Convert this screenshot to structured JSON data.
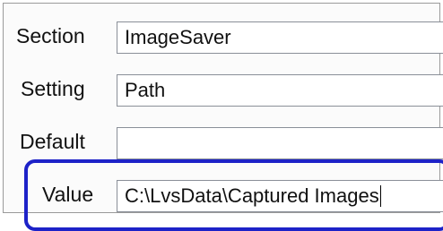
{
  "form": {
    "section": {
      "label": "Section",
      "value": "ImageSaver"
    },
    "setting": {
      "label": "Setting",
      "value": "Path"
    },
    "default": {
      "label": "Default",
      "value": ""
    },
    "value": {
      "label": "Value",
      "value": "C:\\LvsData\\Captured Images"
    }
  },
  "colors": {
    "highlight_border": "#1d22c8",
    "field_border": "#8a8f98",
    "panel_border": "#9a9a9a"
  }
}
